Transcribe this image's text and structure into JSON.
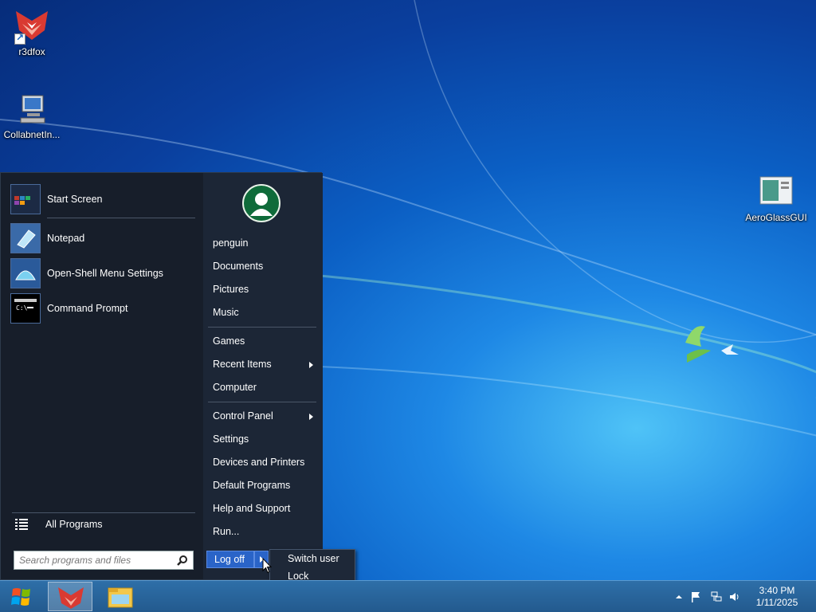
{
  "desktop": {
    "icons": [
      {
        "label": "r3dfox",
        "icon": "fox-icon"
      },
      {
        "label": "CollabnetIn...",
        "icon": "computer-icon"
      },
      {
        "label": "AeroGlassGUI",
        "icon": "window-icon"
      }
    ]
  },
  "start_menu": {
    "programs": [
      {
        "label": "Start Screen",
        "icon": "start-screen-icon"
      },
      {
        "label": "Notepad",
        "icon": "notepad-icon"
      },
      {
        "label": "Open-Shell Menu Settings",
        "icon": "shell-icon"
      },
      {
        "label": "Command Prompt",
        "icon": "cmd-icon"
      }
    ],
    "all_programs": "All Programs",
    "search_placeholder": "Search programs and files",
    "user_name": "penguin",
    "right_items": [
      "Documents",
      "Pictures",
      "Music",
      "Games",
      "Recent Items",
      "Computer",
      "Control Panel",
      "Settings",
      "Devices and Printers",
      "Default Programs",
      "Help and Support",
      "Run..."
    ],
    "logoff_label": "Log off",
    "logoff_submenu": [
      "Switch user",
      "Lock"
    ]
  },
  "taskbar": {
    "clock_time": "3:40 PM",
    "clock_date": "1/11/2025"
  },
  "colors": {
    "accent": "#2a64c8",
    "menu_bg": "#1a2230",
    "taskbar": "#2e6fa8"
  }
}
